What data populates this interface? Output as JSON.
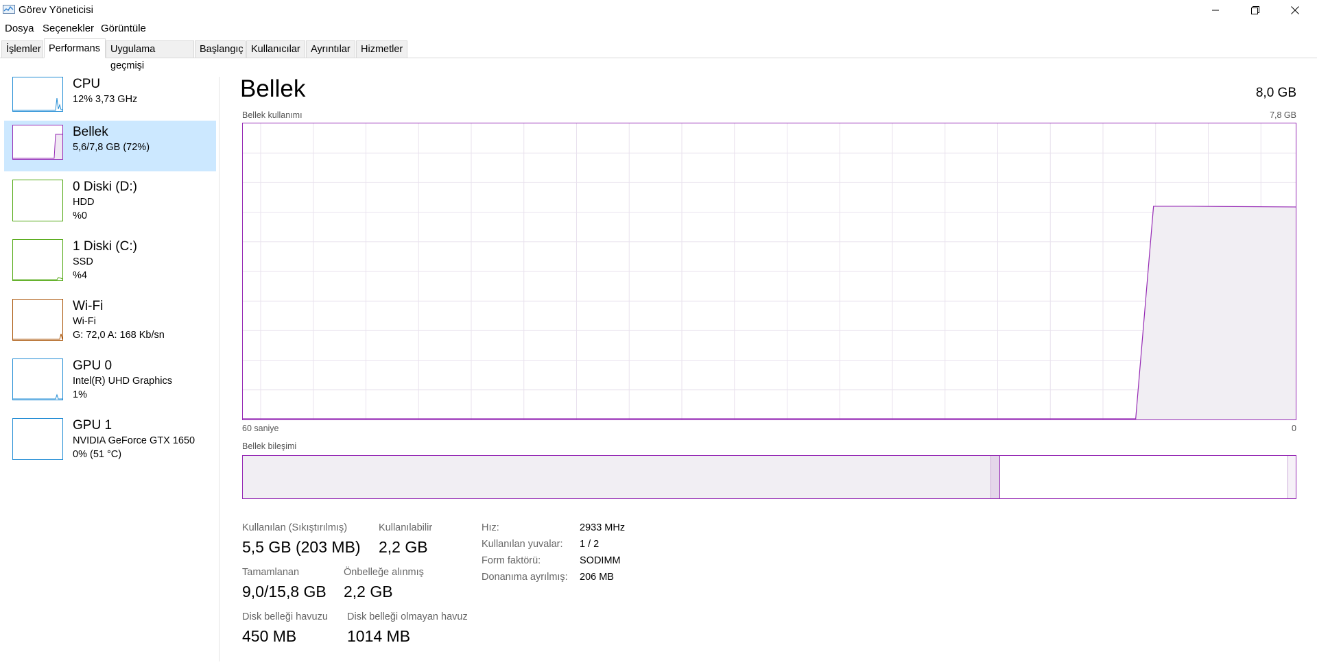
{
  "window": {
    "title": "Görev Yöneticisi",
    "controls": {
      "minimize": "minimize",
      "restore": "restore",
      "close": "close"
    }
  },
  "menu": [
    "Dosya",
    "Seçenekler",
    "Görüntüle"
  ],
  "tabs": [
    {
      "label": "İşlemler",
      "active": false
    },
    {
      "label": "Performans",
      "active": true
    },
    {
      "label": "Uygulama geçmişi",
      "active": false
    },
    {
      "label": "Başlangıç",
      "active": false
    },
    {
      "label": "Kullanıcılar",
      "active": false
    },
    {
      "label": "Ayrıntılar",
      "active": false
    },
    {
      "label": "Hizmetler",
      "active": false
    }
  ],
  "sidebar": {
    "items": [
      {
        "name": "CPU",
        "line1": "12%  3,73 GHz",
        "line2": "",
        "color": "#1f8bd4",
        "active": false
      },
      {
        "name": "Bellek",
        "line1": "5,6/7,8 GB (72%)",
        "line2": "",
        "color": "#9528b4",
        "active": true
      },
      {
        "name": "0 Diski (D:)",
        "line1": "HDD",
        "line2": "%0",
        "color": "#4da60c",
        "active": false
      },
      {
        "name": "1 Diski (C:)",
        "line1": "SSD",
        "line2": "%4",
        "color": "#4da60c",
        "active": false
      },
      {
        "name": "Wi-Fi",
        "line1": "Wi-Fi",
        "line2": "G: 72,0  A: 168 Kb/sn",
        "color": "#a74f01",
        "active": false
      },
      {
        "name": "GPU 0",
        "line1": "Intel(R) UHD Graphics",
        "line2": "1%",
        "color": "#1f8bd4",
        "active": false
      },
      {
        "name": "GPU 1",
        "line1": "NVIDIA GeForce GTX 1650",
        "line2": "0% (51 °C)",
        "color": "#1f8bd4",
        "active": false
      }
    ]
  },
  "main": {
    "title": "Bellek",
    "total": "8,0 GB",
    "usage_label": "Bellek kullanımı",
    "usage_max": "7,8 GB",
    "time_left": "60 saniye",
    "time_right": "0",
    "composition_label": "Bellek bileşimi",
    "accent_color": "#9528b4",
    "usage_history": {
      "unit": "fraction of 7,8 GB",
      "start_fraction": 0.848,
      "level": 0.72
    },
    "composition": {
      "in_use_fraction": 0.71,
      "modified_fraction": 0.008,
      "standby_fraction": 0.273,
      "free_fraction": 0.009
    },
    "stats": {
      "used_label": "Kullanılan (Sıkıştırılmış)",
      "used_value": "5,5 GB (203 MB)",
      "available_label": "Kullanılabilir",
      "available_value": "2,2 GB",
      "committed_label": "Tamamlanan",
      "committed_value": "9,0/15,8 GB",
      "cached_label": "Önbelleğe alınmış",
      "cached_value": "2,2 GB",
      "paged_label": "Disk belleği havuzu",
      "paged_value": "450 MB",
      "nonpaged_label": "Disk belleği olmayan havuz",
      "nonpaged_value": "1014 MB"
    },
    "info": [
      {
        "key": "Hız:",
        "value": "2933 MHz"
      },
      {
        "key": "Kullanılan yuvalar:",
        "value": "1 / 2"
      },
      {
        "key": "Form faktörü:",
        "value": "SODIMM"
      },
      {
        "key": "Donanıma ayrılmış:",
        "value": "206 MB"
      }
    ]
  }
}
